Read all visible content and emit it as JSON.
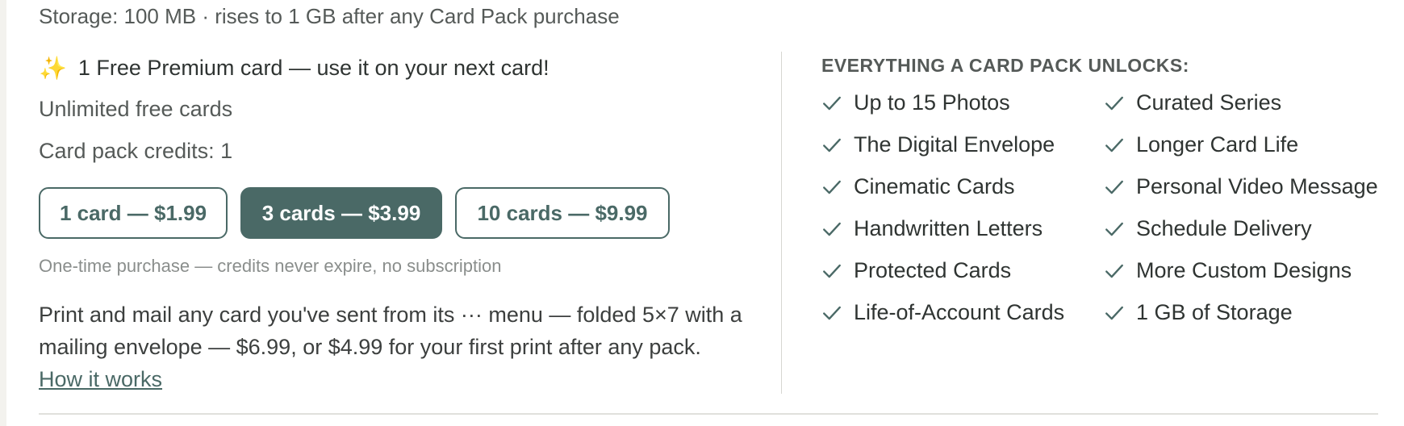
{
  "storage_text": "Storage: 100 MB · rises to 1 GB after any Card Pack purchase",
  "free_premium": {
    "icon": "sparkles-icon",
    "glyph": "✨",
    "text": "1 Free Premium card — use it on your next card!"
  },
  "unlimited_text": "Unlimited free cards",
  "credits_text": "Card pack credits: 1",
  "packs": [
    {
      "label": "1 card — $1.99",
      "selected": false
    },
    {
      "label": "3 cards — $3.99",
      "selected": true
    },
    {
      "label": "10 cards — $9.99",
      "selected": false
    }
  ],
  "onetime_note": "One-time purchase — credits never expire, no subscription",
  "print": {
    "text": "Print and mail any card you've sent from its ··· menu — folded 5×7 with a mailing envelope — $6.99, or $4.99 for your first print after any pack.",
    "link": "How it works"
  },
  "unlocks": {
    "heading": "EVERYTHING A CARD PACK UNLOCKS:",
    "left": [
      "Up to 15 Photos",
      "The Digital Envelope",
      "Cinematic Cards",
      "Handwritten Letters",
      "Protected Cards",
      "Life-of-Account Cards"
    ],
    "right": [
      "Curated Series",
      "Longer Card Life",
      "Personal Video Message",
      "Schedule Delivery",
      "More Custom Designs",
      "1 GB of Storage"
    ]
  },
  "colors": {
    "accent": "#4a6966",
    "text": "#3c3f3e",
    "muted": "#8a8e8c"
  }
}
